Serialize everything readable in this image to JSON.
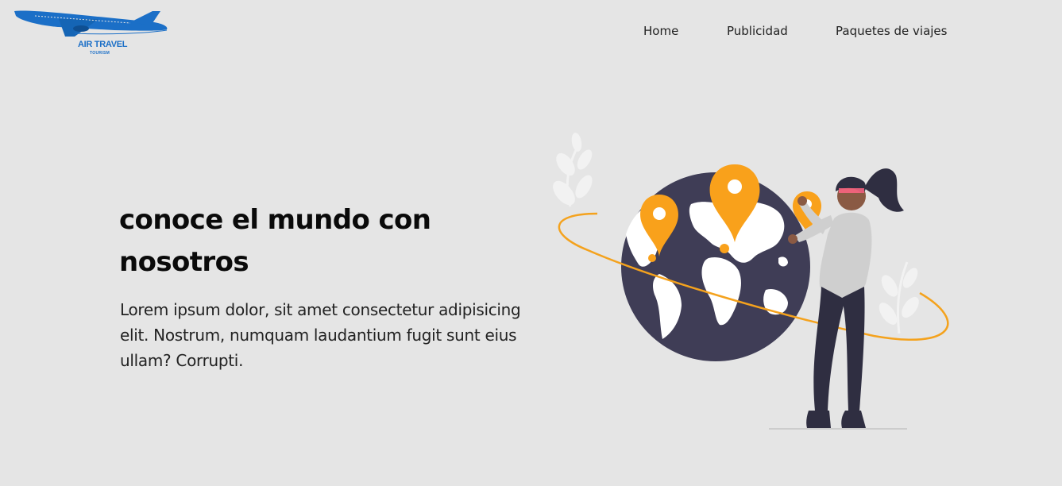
{
  "brand": {
    "name": "AIR TRAVEL",
    "tagline": "TOURISM",
    "icon": "airplane-icon",
    "color": "#1b6fc7"
  },
  "nav": {
    "items": [
      {
        "label": "Home"
      },
      {
        "label": "Publicidad"
      },
      {
        "label": "Paquetes de viajes"
      }
    ]
  },
  "hero": {
    "title": "conoce el mundo con nosotros",
    "text": "Lorem ipsum dolor, sit amet consectetur adipisicing elit. Nostrum, numquam laudantium fugit sunt eius ullam? Corrupti.",
    "illustration": "woman-pinning-locations-on-globe-illustration"
  },
  "colors": {
    "background": "#e5e5e5",
    "globe": "#3f3d56",
    "pin": "#f9a11b",
    "orbit": "#f4a21d"
  }
}
